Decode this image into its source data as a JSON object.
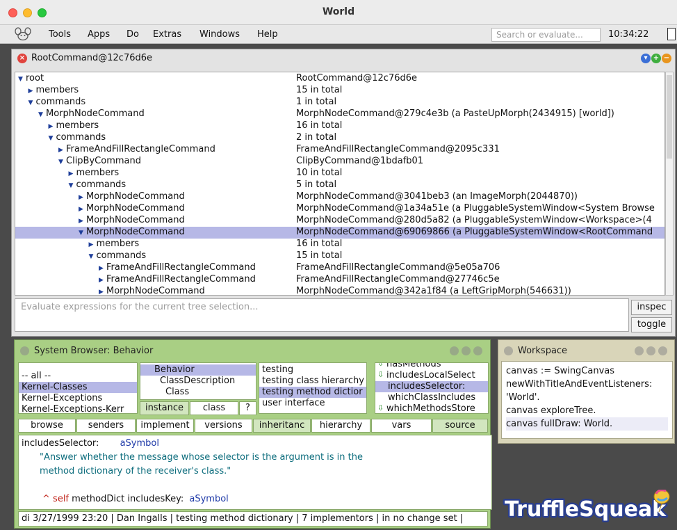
{
  "window": {
    "title": "World"
  },
  "menubar": {
    "items": [
      "Tools",
      "Apps",
      "Do",
      "Extras",
      "Windows",
      "Help"
    ],
    "search_placeholder": "Search or evaluate...",
    "clock": "10:34:22"
  },
  "root_window": {
    "title": "RootCommand@12c76d6e",
    "rows": [
      {
        "indent": 0,
        "arrow": "down",
        "name": "root",
        "value": "RootCommand@12c76d6e"
      },
      {
        "indent": 1,
        "arrow": "right",
        "name": "members",
        "value": "15 in total"
      },
      {
        "indent": 1,
        "arrow": "down",
        "name": "commands",
        "value": "1 in total"
      },
      {
        "indent": 2,
        "arrow": "down",
        "name": "MorphNodeCommand",
        "value": "MorphNodeCommand@279c4e3b (a PasteUpMorph(2434915) [world])"
      },
      {
        "indent": 3,
        "arrow": "right",
        "name": "members",
        "value": "16 in total"
      },
      {
        "indent": 3,
        "arrow": "down",
        "name": "commands",
        "value": "2 in total"
      },
      {
        "indent": 4,
        "arrow": "right",
        "name": "FrameAndFillRectangleCommand",
        "value": "FrameAndFillRectangleCommand@2095c331"
      },
      {
        "indent": 4,
        "arrow": "down",
        "name": "ClipByCommand",
        "value": "ClipByCommand@1bdafb01"
      },
      {
        "indent": 5,
        "arrow": "right",
        "name": "members",
        "value": "10 in total"
      },
      {
        "indent": 5,
        "arrow": "down",
        "name": "commands",
        "value": "5 in total"
      },
      {
        "indent": 6,
        "arrow": "right",
        "name": "MorphNodeCommand",
        "value": "MorphNodeCommand@3041beb3 (an ImageMorph(2044870))"
      },
      {
        "indent": 6,
        "arrow": "right",
        "name": "MorphNodeCommand",
        "value": "MorphNodeCommand@1a34a51e (a PluggableSystemWindow<System Browse"
      },
      {
        "indent": 6,
        "arrow": "right",
        "name": "MorphNodeCommand",
        "value": "MorphNodeCommand@280d5a82 (a PluggableSystemWindow<Workspace>(4"
      },
      {
        "indent": 6,
        "arrow": "down",
        "name": "MorphNodeCommand",
        "value": "MorphNodeCommand@69069866 (a PluggableSystemWindow<RootCommand",
        "selected": true
      },
      {
        "indent": 7,
        "arrow": "right",
        "name": "members",
        "value": "16 in total"
      },
      {
        "indent": 7,
        "arrow": "down",
        "name": "commands",
        "value": "15 in total"
      },
      {
        "indent": 8,
        "arrow": "right",
        "name": "FrameAndFillRectangleCommand",
        "value": "FrameAndFillRectangleCommand@5e05a706"
      },
      {
        "indent": 8,
        "arrow": "right",
        "name": "FrameAndFillRectangleCommand",
        "value": "FrameAndFillRectangleCommand@27746c5e"
      },
      {
        "indent": 8,
        "arrow": "right",
        "name": "MorphNodeCommand",
        "value": "MorphNodeCommand@342a1f84 (a LeftGripMorph(546631))"
      }
    ],
    "eval_placeholder": "Evaluate expressions for the current tree selection...",
    "inspect_label": "inspec",
    "toggle_label": "toggle"
  },
  "browser": {
    "title": "System Browser: Behavior",
    "categories": [
      "-- all --",
      "Kernel-Classes",
      "Kernel-Exceptions",
      "Kernel-Exceptions-Kerr"
    ],
    "categories_selected": 1,
    "classes": [
      "Behavior",
      "ClassDescription",
      "Class"
    ],
    "classes_selected": 0,
    "instance_label": "instance",
    "class_label": "class",
    "help_label": "?",
    "protocols": [
      "testing",
      "testing class hierarchy",
      "testing method dictior",
      "user interface"
    ],
    "protocols_selected": 2,
    "methods": [
      "hasMethods",
      "includesLocalSelect",
      "includesSelector:",
      "whichClassIncludes",
      "whichMethodsStore"
    ],
    "methods_selected": 2,
    "tabs": [
      "browse",
      "senders",
      "implement",
      "versions",
      "inheritanc",
      "hierarchy",
      "vars",
      "source"
    ],
    "code": {
      "sig_selector": "includesSelector:",
      "sig_arg": "aSymbol",
      "comment_line1": "\"Answer whether the message whose selector is the argument is in the",
      "comment_line2": "method dictionary of the receiver's class.\"",
      "ret_caret": "^",
      "ret_self": "self",
      "ret_body": "methodDict includesKey:",
      "ret_arg": "aSymbol"
    },
    "status": "di 3/27/1999 23:20 | Dan Ingalls | testing method dictionary | 7 implementors | in no change set |"
  },
  "workspace": {
    "title": "Workspace",
    "lines": [
      "canvas := SwingCanvas",
      "newWithTitleAndEventListeners:",
      "'World'.",
      "canvas exploreTree.",
      "canvas fullDraw: World."
    ]
  },
  "logo": {
    "text": "TruffleSqueak"
  },
  "colors": {
    "selection": "#b6b8e6",
    "browser_bg": "#a9cf84",
    "workspace_bg": "#d9d5b9",
    "keyword_blue": "#1f3aa8",
    "comment_teal": "#0d6d7d",
    "caret_red": "#c0231a"
  }
}
